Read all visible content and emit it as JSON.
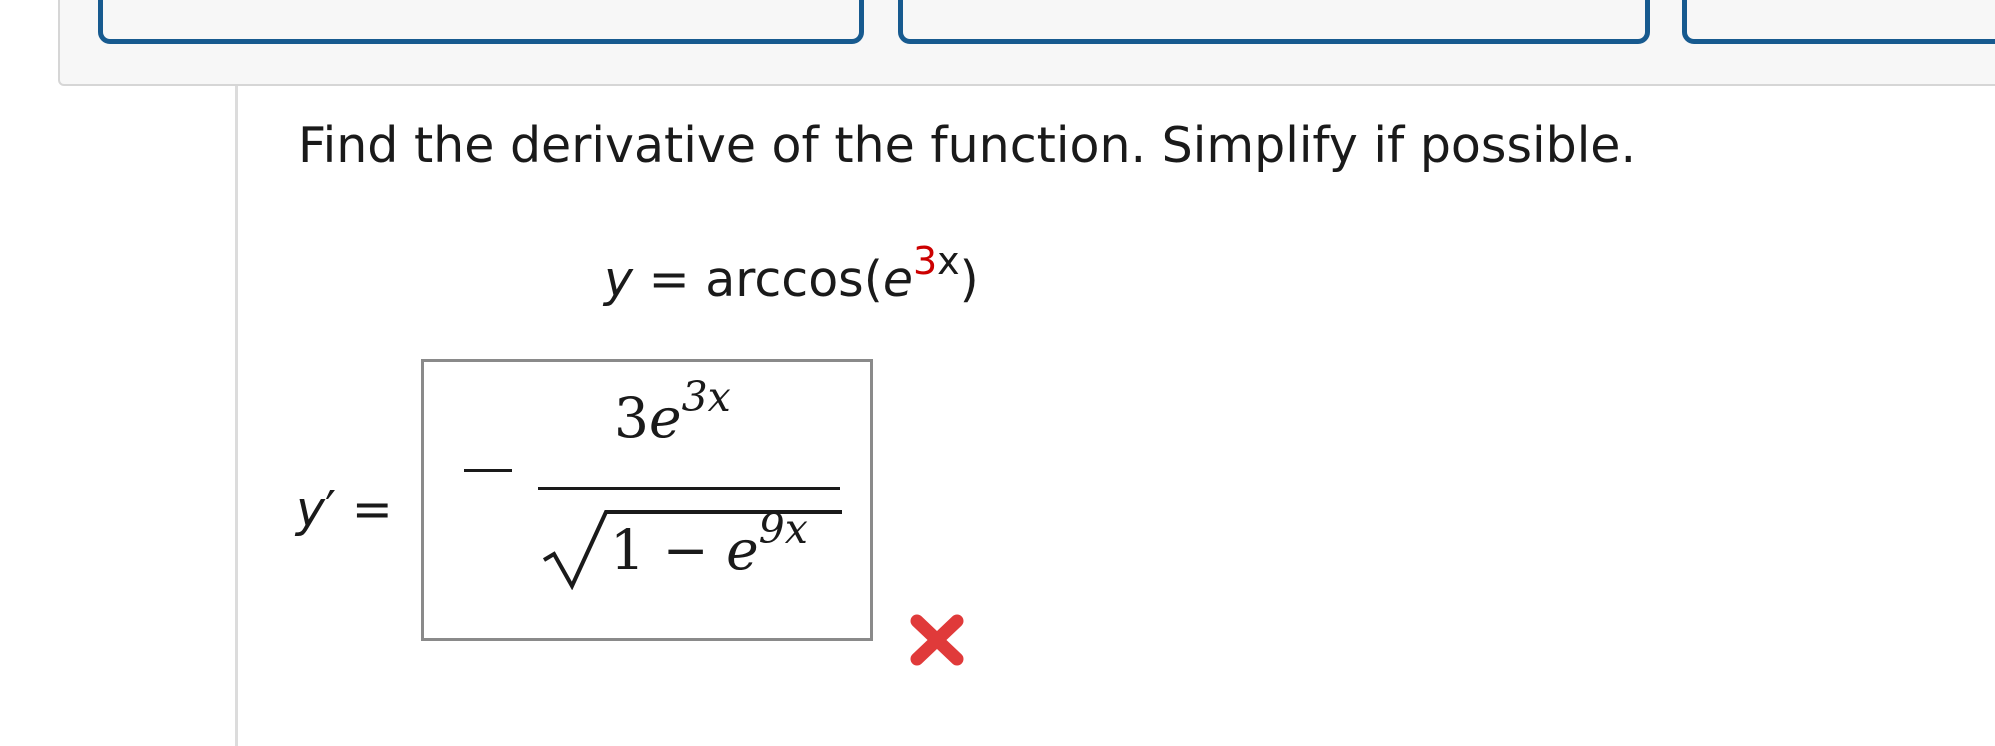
{
  "top_bar": {
    "tabs": [
      "",
      "",
      ""
    ]
  },
  "question": {
    "instruction": "Find the derivative of the function. Simplify if possible.",
    "equation": {
      "lhs": "y",
      "equals": "=",
      "function_name": "arccos",
      "open_paren": "(",
      "base": "e",
      "exponent_coeff": "3",
      "exponent_var": "x",
      "close_paren": ")"
    }
  },
  "answer": {
    "label_var": "y",
    "label_prime": "′",
    "label_equals": "=",
    "numerator_coeff": "3",
    "numerator_base": "e",
    "numerator_exp": "3x",
    "radicand_const": "1",
    "radicand_minus": "−",
    "radicand_base": "e",
    "radicand_exp": "9x",
    "status": "incorrect",
    "status_color": "#e03a3a"
  },
  "colors": {
    "tab_border": "#175a8f",
    "exponent_highlight": "#cc0000"
  }
}
